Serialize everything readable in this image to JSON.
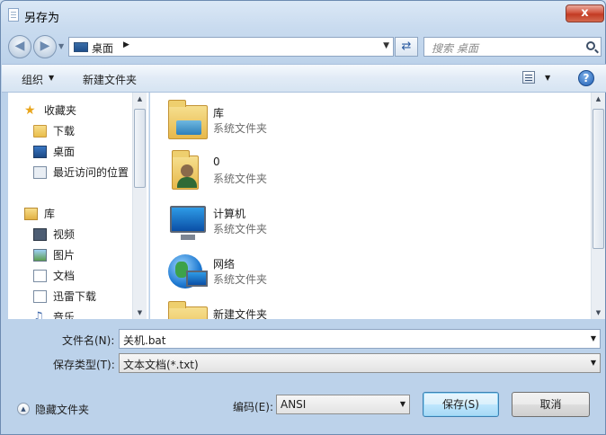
{
  "window": {
    "title": "另存为",
    "close_label": "x"
  },
  "address": {
    "path": "桌面",
    "search_placeholder": "搜索 桌面"
  },
  "toolbar": {
    "organize_label": "组织",
    "new_folder_label": "新建文件夹",
    "help_label": "?"
  },
  "nav": {
    "items": [
      {
        "label": "收藏夹"
      },
      {
        "label": "下载"
      },
      {
        "label": "桌面"
      },
      {
        "label": "最近访问的位置"
      },
      {
        "label": "库"
      },
      {
        "label": "视频"
      },
      {
        "label": "图片"
      },
      {
        "label": "文档"
      },
      {
        "label": "迅雷下载"
      },
      {
        "label": "音乐"
      }
    ]
  },
  "files": [
    {
      "name": "库",
      "type": "系统文件夹"
    },
    {
      "name": "0",
      "type": "系统文件夹"
    },
    {
      "name": "计算机",
      "type": "系统文件夹"
    },
    {
      "name": "网络",
      "type": "系统文件夹"
    },
    {
      "name": "新建文件夹",
      "type": ""
    }
  ],
  "form": {
    "filename_label": "文件名(N):",
    "filename_value": "关机.bat",
    "filetype_label": "保存类型(T):",
    "filetype_value": "文本文档(*.txt)",
    "encoding_label": "编码(E):",
    "encoding_value": "ANSI"
  },
  "footer": {
    "hide_folders_label": "隐藏文件夹",
    "save_label": "保存(S)",
    "cancel_label": "取消"
  }
}
